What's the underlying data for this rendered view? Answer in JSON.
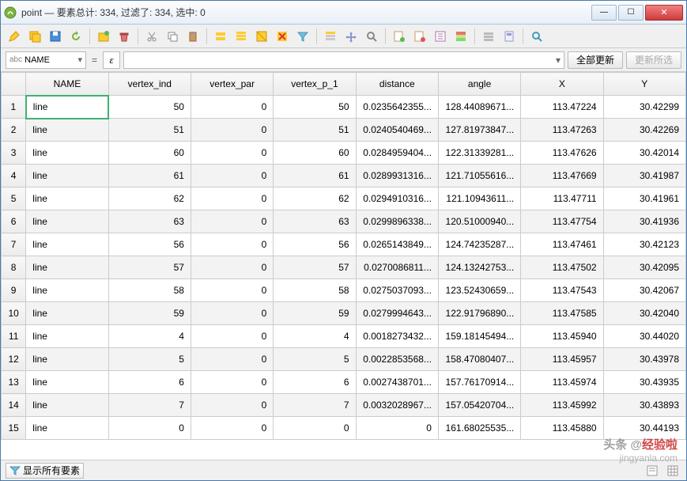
{
  "window": {
    "title": "point — 要素总计: 334, 过滤了: 334, 选中: 0",
    "min": "—",
    "max": "☐",
    "close": "✕"
  },
  "filter": {
    "field_prefix": "abc",
    "field_name": "NAME",
    "eq": "=",
    "epsilon": "ε",
    "update_all": "全部更新",
    "update_sel": "更新所选"
  },
  "columns": [
    "",
    "NAME",
    "vertex_ind",
    "vertex_par",
    "vertex_p_1",
    "distance",
    "angle",
    "X",
    "Y"
  ],
  "rows": [
    {
      "n": "1",
      "name": "line",
      "vi": "50",
      "vp": "0",
      "vp1": "50",
      "d": "0.0235642355...",
      "a": "128.44089671...",
      "x": "113.47224",
      "y": "30.42299"
    },
    {
      "n": "2",
      "name": "line",
      "vi": "51",
      "vp": "0",
      "vp1": "51",
      "d": "0.0240540469...",
      "a": "127.81973847...",
      "x": "113.47263",
      "y": "30.42269"
    },
    {
      "n": "3",
      "name": "line",
      "vi": "60",
      "vp": "0",
      "vp1": "60",
      "d": "0.0284959404...",
      "a": "122.31339281...",
      "x": "113.47626",
      "y": "30.42014"
    },
    {
      "n": "4",
      "name": "line",
      "vi": "61",
      "vp": "0",
      "vp1": "61",
      "d": "0.0289931316...",
      "a": "121.71055616...",
      "x": "113.47669",
      "y": "30.41987"
    },
    {
      "n": "5",
      "name": "line",
      "vi": "62",
      "vp": "0",
      "vp1": "62",
      "d": "0.0294910316...",
      "a": "121.10943611...",
      "x": "113.47711",
      "y": "30.41961"
    },
    {
      "n": "6",
      "name": "line",
      "vi": "63",
      "vp": "0",
      "vp1": "63",
      "d": "0.0299896338...",
      "a": "120.51000940...",
      "x": "113.47754",
      "y": "30.41936"
    },
    {
      "n": "7",
      "name": "line",
      "vi": "56",
      "vp": "0",
      "vp1": "56",
      "d": "0.0265143849...",
      "a": "124.74235287...",
      "x": "113.47461",
      "y": "30.42123"
    },
    {
      "n": "8",
      "name": "line",
      "vi": "57",
      "vp": "0",
      "vp1": "57",
      "d": "0.0270086811...",
      "a": "124.13242753...",
      "x": "113.47502",
      "y": "30.42095"
    },
    {
      "n": "9",
      "name": "line",
      "vi": "58",
      "vp": "0",
      "vp1": "58",
      "d": "0.0275037093...",
      "a": "123.52430659...",
      "x": "113.47543",
      "y": "30.42067"
    },
    {
      "n": "10",
      "name": "line",
      "vi": "59",
      "vp": "0",
      "vp1": "59",
      "d": "0.0279994643...",
      "a": "122.91796890...",
      "x": "113.47585",
      "y": "30.42040"
    },
    {
      "n": "11",
      "name": "line",
      "vi": "4",
      "vp": "0",
      "vp1": "4",
      "d": "0.0018273432...",
      "a": "159.18145494...",
      "x": "113.45940",
      "y": "30.44020"
    },
    {
      "n": "12",
      "name": "line",
      "vi": "5",
      "vp": "0",
      "vp1": "5",
      "d": "0.0022853568...",
      "a": "158.47080407...",
      "x": "113.45957",
      "y": "30.43978"
    },
    {
      "n": "13",
      "name": "line",
      "vi": "6",
      "vp": "0",
      "vp1": "6",
      "d": "0.0027438701...",
      "a": "157.76170914...",
      "x": "113.45974",
      "y": "30.43935"
    },
    {
      "n": "14",
      "name": "line",
      "vi": "7",
      "vp": "0",
      "vp1": "7",
      "d": "0.0032028967...",
      "a": "157.05420704...",
      "x": "113.45992",
      "y": "30.43893"
    },
    {
      "n": "15",
      "name": "line",
      "vi": "0",
      "vp": "0",
      "vp1": "0",
      "d": "0",
      "a": "161.68025535...",
      "x": "113.45880",
      "y": "30.44193"
    }
  ],
  "status": {
    "show_all": "显示所有要素"
  },
  "watermark": {
    "line1a": "头条 @",
    "line1b": "经验啦",
    "line2": "jingyanla.com"
  }
}
